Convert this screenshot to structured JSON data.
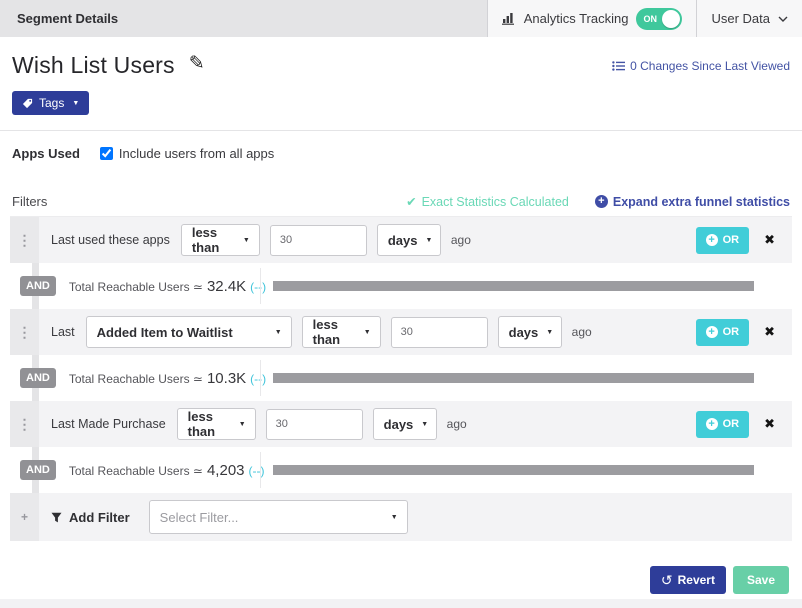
{
  "header": {
    "title": "Segment Details",
    "analytics_tracking_label": "Analytics Tracking",
    "toggle_label": "ON",
    "user_data_label": "User Data"
  },
  "segment": {
    "name": "Wish List Users",
    "changes_link": "0 Changes Since Last Viewed",
    "tags_button": "Tags"
  },
  "apps_used": {
    "label": "Apps Used",
    "checkbox_label": "Include users from all apps",
    "checked": true
  },
  "filters": {
    "section_label": "Filters",
    "exact_statistics": "Exact Statistics Calculated",
    "expand_link": "Expand extra funnel statistics",
    "labels": {
      "and": "AND",
      "or": "OR",
      "ago": "ago",
      "reachable": "Total Reachable Users ≃"
    },
    "rows": [
      {
        "label": "Last used these apps",
        "comparator": "less than",
        "value": "30",
        "unit": "days",
        "reachable": "32.4K",
        "stats_link": "(--)"
      },
      {
        "label": "Last",
        "event": "Added Item to Waitlist",
        "comparator": "less than",
        "value": "30",
        "unit": "days",
        "reachable": "10.3K",
        "stats_link": "(--)"
      },
      {
        "label": "Last Made Purchase",
        "comparator": "less than",
        "value": "30",
        "unit": "days",
        "reachable": "4,203",
        "stats_link": "(--)"
      }
    ],
    "add_filter": {
      "label": "Add Filter",
      "placeholder": "Select Filter..."
    }
  },
  "footer": {
    "revert": "Revert",
    "save": "Save"
  },
  "icons": {
    "drag_handle": "⋮",
    "close": "✖",
    "caret_down": "▼",
    "check": "✔",
    "plus": "+",
    "pencil": "✎",
    "revert": "↺"
  },
  "colors": {
    "accent_indigo": "#2e3d99",
    "accent_cyan": "#41cdd8",
    "accent_mint": "#68cfa7",
    "toggle_green": "#3fc89c",
    "link_indigo": "#4353a4",
    "stat_teal": "#6ad8b6"
  }
}
